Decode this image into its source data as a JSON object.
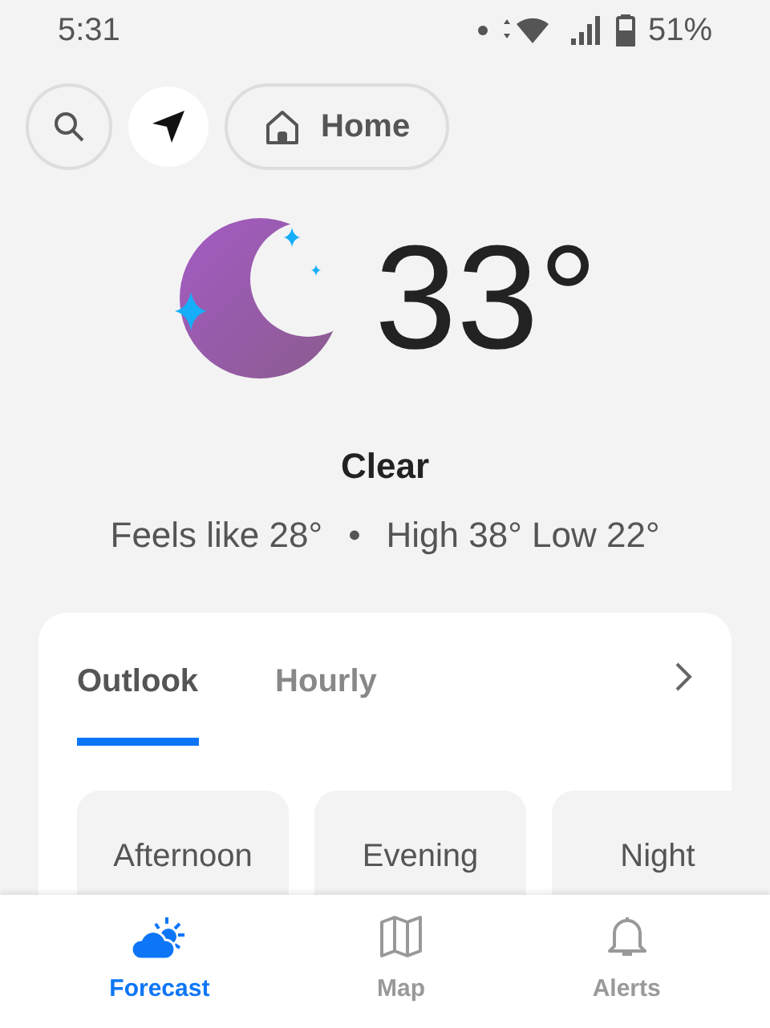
{
  "status_bar": {
    "time": "5:31",
    "battery": "51%"
  },
  "top_buttons": [
    {
      "kind": "search",
      "selected": false
    },
    {
      "kind": "location",
      "selected": true
    },
    {
      "kind": "home",
      "label": "Home",
      "selected": false
    }
  ],
  "current": {
    "temperature": "33°",
    "condition": "Clear",
    "feels_like": "Feels like 28°",
    "separator": "•",
    "high_low": "High 38° Low 22°"
  },
  "forecast_card": {
    "tabs": [
      {
        "label": "Outlook",
        "selected": true
      },
      {
        "label": "Hourly",
        "selected": false
      }
    ],
    "periods": [
      {
        "label": "Afternoon"
      },
      {
        "label": "Evening"
      },
      {
        "label": "Night"
      }
    ]
  },
  "bottom_nav": [
    {
      "kind": "forecast",
      "label": "Forecast",
      "selected": true
    },
    {
      "kind": "map",
      "label": "Map",
      "selected": false
    },
    {
      "kind": "alerts",
      "label": "Alerts",
      "selected": false
    }
  ]
}
